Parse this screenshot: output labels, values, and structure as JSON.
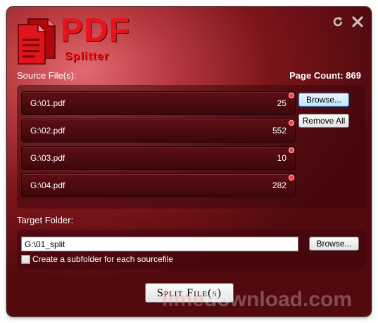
{
  "app": {
    "logo_main": "PDF",
    "logo_sub": "Splitter"
  },
  "window_controls": {
    "refresh_icon": "refresh-icon",
    "close_icon": "close-icon"
  },
  "source": {
    "label": "Source File(s):",
    "page_count_label": "Page Count: 869",
    "files": [
      {
        "name": "G:\\01.pdf",
        "pages": "25"
      },
      {
        "name": "G:\\02.pdf",
        "pages": "552"
      },
      {
        "name": "G:\\03.pdf",
        "pages": "10"
      },
      {
        "name": "G:\\04.pdf",
        "pages": "282"
      }
    ],
    "browse_label": "Browse...",
    "remove_all_label": "Remove All"
  },
  "target": {
    "label": "Target Folder:",
    "path": "G:\\01_split",
    "browse_label": "Browse...",
    "subfolder_label": "Create a subfolder for each sourcefile",
    "subfolder_checked": false
  },
  "actions": {
    "split_label": "Split File(s)"
  },
  "watermark": {
    "part1": "lime",
    "part2": "download.com"
  },
  "colors": {
    "accent": "#e8141c",
    "background": "#7c151b"
  }
}
